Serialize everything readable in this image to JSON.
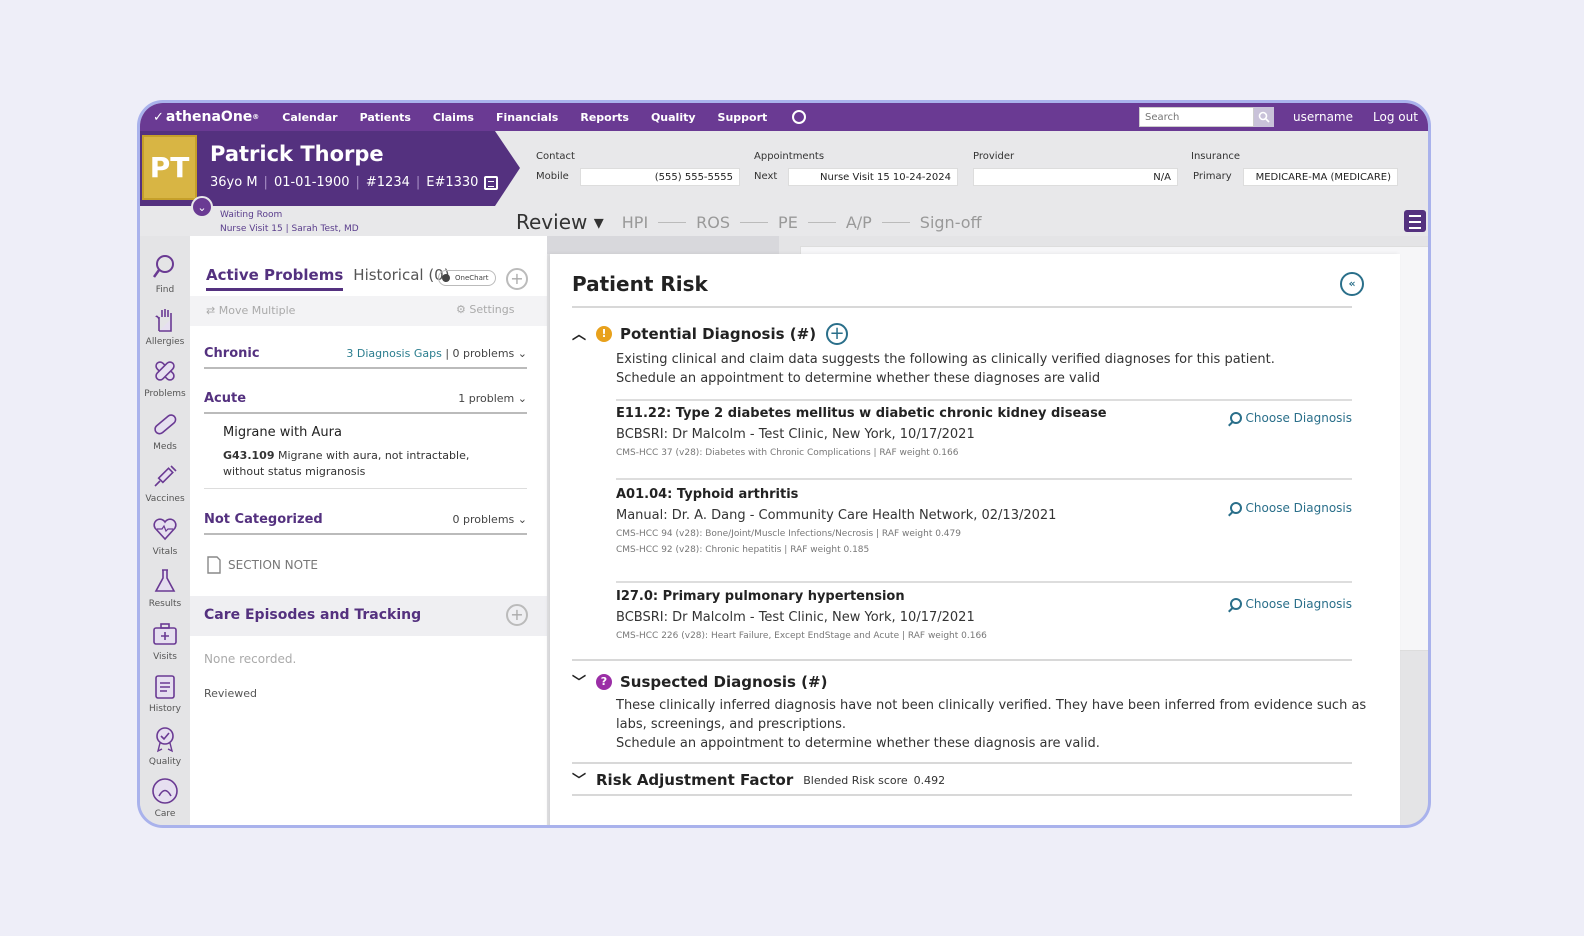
{
  "topnav": {
    "logo": "athenaOne",
    "items": [
      "Calendar",
      "Patients",
      "Claims",
      "Financials",
      "Reports",
      "Quality",
      "Support"
    ],
    "search_placeholder": "Search",
    "username": "username",
    "logout": "Log out"
  },
  "patient": {
    "initials": "PT",
    "name": "Patrick Thorpe",
    "age_sex": "36yo M",
    "dob": "01-01-1900",
    "id": "#1234",
    "encounter": "E#1330"
  },
  "contact": {
    "label": "Contact",
    "sub": "Mobile",
    "value": "(555) 555-5555"
  },
  "appointments": {
    "label": "Appointments",
    "sub": "Next",
    "value": "Nurse Visit 15 10-24-2024"
  },
  "provider": {
    "label": "Provider",
    "value": "N/A"
  },
  "insurance": {
    "label": "Insurance",
    "sub": "Primary",
    "value": "MEDICARE-MA (MEDICARE)"
  },
  "waiting": {
    "line1": "Waiting Room",
    "line2a": "Nurse Visit 15",
    "line2b": "Sarah Test, MD"
  },
  "steps": {
    "active": "Review",
    "items": [
      "HPI",
      "ROS",
      "PE",
      "A/P",
      "Sign-off"
    ]
  },
  "rail": [
    "Find",
    "Allergies",
    "Problems",
    "Meds",
    "Vaccines",
    "Vitals",
    "Results",
    "Visits",
    "History",
    "Quality",
    "Care"
  ],
  "problems": {
    "tab_active": "Active Problems",
    "tab_historical": "Historical (0)",
    "toggle": "OneChart",
    "move_multiple": "Move Multiple",
    "settings": "Settings",
    "chronic": {
      "title": "Chronic",
      "gaps": "3 Diagnosis Gaps",
      "count": "0 problems"
    },
    "acute": {
      "title": "Acute",
      "count": "1 problem"
    },
    "acute_item": {
      "name": "Migrane with Aura",
      "code": "G43.109",
      "desc1": "Migrane with aura, not intractable,",
      "desc2": "without status migranosis"
    },
    "notcat": {
      "title": "Not Categorized",
      "count": "0 problems"
    },
    "section_note": "SECTION NOTE"
  },
  "care": {
    "title": "Care Episodes and Tracking",
    "none": "None recorded.",
    "reviewed": "Reviewed"
  },
  "risk": {
    "title": "Patient Risk",
    "potential": {
      "title": "Potential Diagnosis (#)",
      "desc1": "Existing clinical and claim data suggests the following as clinically verified diagnoses for this patient.",
      "desc2": "Schedule an appointment to determine whether these diagnoses are valid"
    },
    "choose_label": "Choose Diagnosis",
    "diagnoses": [
      {
        "code": "E11.22: Type 2 diabetes mellitus w diabetic chronic kidney disease",
        "source": "BCBSRI: Dr Malcolm - Test Clinic, New York, 10/17/2021",
        "meta1": "CMS-HCC 37 (v28): Diabetes with Chronic Complications  |  RAF weight 0.166",
        "meta2": ""
      },
      {
        "code": "A01.04: Typhoid arthritis",
        "source": "Manual: Dr. A. Dang - Community Care Health Network, 02/13/2021",
        "meta1": "CMS-HCC 94 (v28): Bone/Joint/Muscle Infections/Necrosis  |  RAF weight 0.479",
        "meta2": "CMS-HCC 92 (v28): Chronic hepatitis  |  RAF weight 0.185"
      },
      {
        "code": "I27.0: Primary pulmonary hypertension",
        "source": "BCBSRI: Dr Malcolm - Test Clinic, New York, 10/17/2021",
        "meta1": "CMS-HCC 226 (v28): Heart Failure, Except EndStage and Acute  |  RAF weight 0.166",
        "meta2": ""
      }
    ],
    "suspected": {
      "title": "Suspected Diagnosis (#)",
      "desc1": "These clinically inferred diagnosis have not been clinically verified.  They have been inferred from evidence such as",
      "desc2": "labs, screenings, and prescriptions.",
      "desc3": "Schedule an appointment to determine whether these diagnosis are valid."
    },
    "raf": {
      "title": "Risk Adjustment Factor",
      "label": "Blended Risk score",
      "value": "0.492"
    }
  },
  "colors": {
    "purple": "#6a3a93",
    "banner": "#54317f",
    "teal": "#2a6f8a",
    "gold": "#d8b544",
    "warn": "#e8a11c",
    "suspect": "#9b2ea6"
  }
}
